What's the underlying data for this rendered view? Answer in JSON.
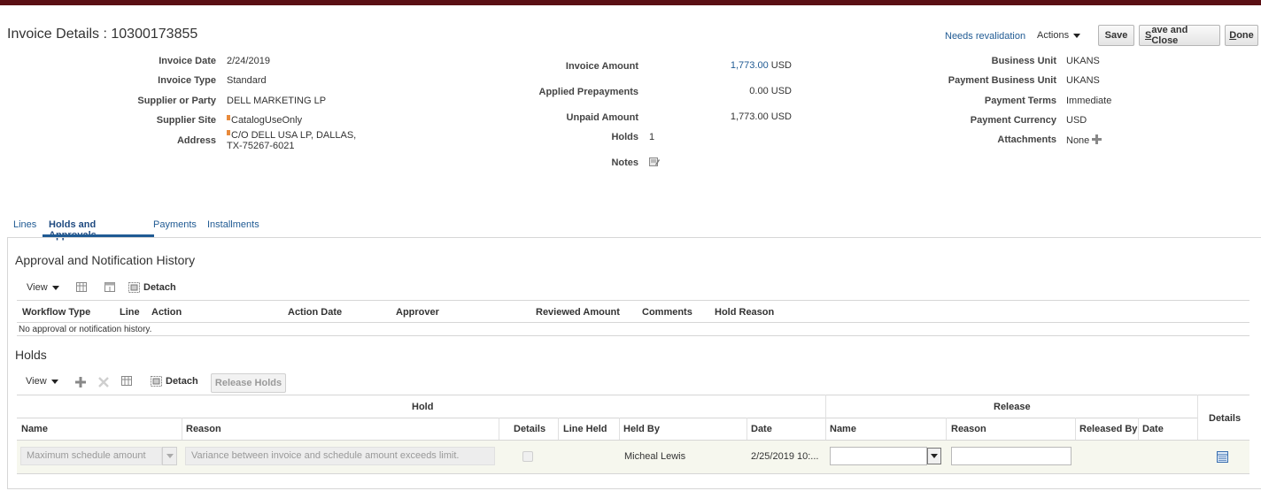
{
  "page": {
    "title": "Invoice Details : 10300173855"
  },
  "header_actions": {
    "needs_revalidation": "Needs revalidation",
    "actions": "Actions",
    "save": "Save",
    "save_and_close_first": "S",
    "save_and_close_rest": "ave and Close",
    "done_first": "D",
    "done_rest": "one"
  },
  "left_fields": [
    {
      "label": "Invoice Date",
      "value": "2/24/2019"
    },
    {
      "label": "Invoice Type",
      "value": "Standard"
    },
    {
      "label": "Supplier or Party",
      "value": "DELL MARKETING LP"
    },
    {
      "label": "Supplier Site",
      "value": "CatalogUseOnly"
    },
    {
      "label": "Address",
      "value_line1": "C/O DELL USA LP, DALLAS,",
      "value_line2": "TX-75267-6021"
    }
  ],
  "middle_fields": {
    "invoice_amount": {
      "label": "Invoice Amount",
      "value": "1,773.00",
      "currency": "USD"
    },
    "applied_prepayments": {
      "label": "Applied Prepayments",
      "value": "0.00 USD"
    },
    "unpaid_amount": {
      "label": "Unpaid Amount",
      "value": "1,773.00 USD"
    },
    "holds": {
      "label": "Holds",
      "value": "1"
    },
    "notes": {
      "label": "Notes"
    }
  },
  "right_fields": [
    {
      "label": "Business Unit",
      "value": "UKANS"
    },
    {
      "label": "Payment Business Unit",
      "value": "UKANS"
    },
    {
      "label": "Payment Terms",
      "value": "Immediate"
    },
    {
      "label": "Payment Currency",
      "value": "USD"
    },
    {
      "label": "Attachments",
      "value": "None"
    }
  ],
  "tabs": [
    {
      "label": "Lines",
      "active": false
    },
    {
      "label": "Holds and Approvals",
      "active": true
    },
    {
      "label": "Payments",
      "active": false
    },
    {
      "label": "Installments",
      "active": false
    }
  ],
  "approval_section": {
    "title": "Approval and Notification History",
    "toolbar": {
      "view": "View",
      "detach": "Detach"
    },
    "columns": [
      "Workflow Type",
      "Line",
      "Action",
      "Action Date",
      "Approver",
      "Reviewed Amount",
      "Comments",
      "Hold Reason"
    ],
    "empty_message": "No approval or notification history."
  },
  "holds_section": {
    "title": "Holds",
    "toolbar": {
      "view": "View",
      "detach": "Detach",
      "release_holds": "Release Holds"
    },
    "group_headers": {
      "hold": "Hold",
      "release": "Release",
      "details": "Details"
    },
    "columns": {
      "name": "Name",
      "reason": "Reason",
      "details": "Details",
      "line_held": "Line Held",
      "held_by": "Held By",
      "date": "Date",
      "release_name": "Name",
      "release_reason": "Reason",
      "released_by": "Released By",
      "release_date": "Date"
    },
    "rows": [
      {
        "name": "Maximum schedule amount",
        "reason": "Variance between invoice and schedule amount exceeds limit.",
        "held_by": "Micheal Lewis",
        "date": "2/25/2019 10:...",
        "release_name": "",
        "release_reason": ""
      }
    ]
  },
  "colors": {
    "accent": "#1f5a93",
    "topbar": "#5b1014",
    "row_bg": "#f6f7ee"
  }
}
